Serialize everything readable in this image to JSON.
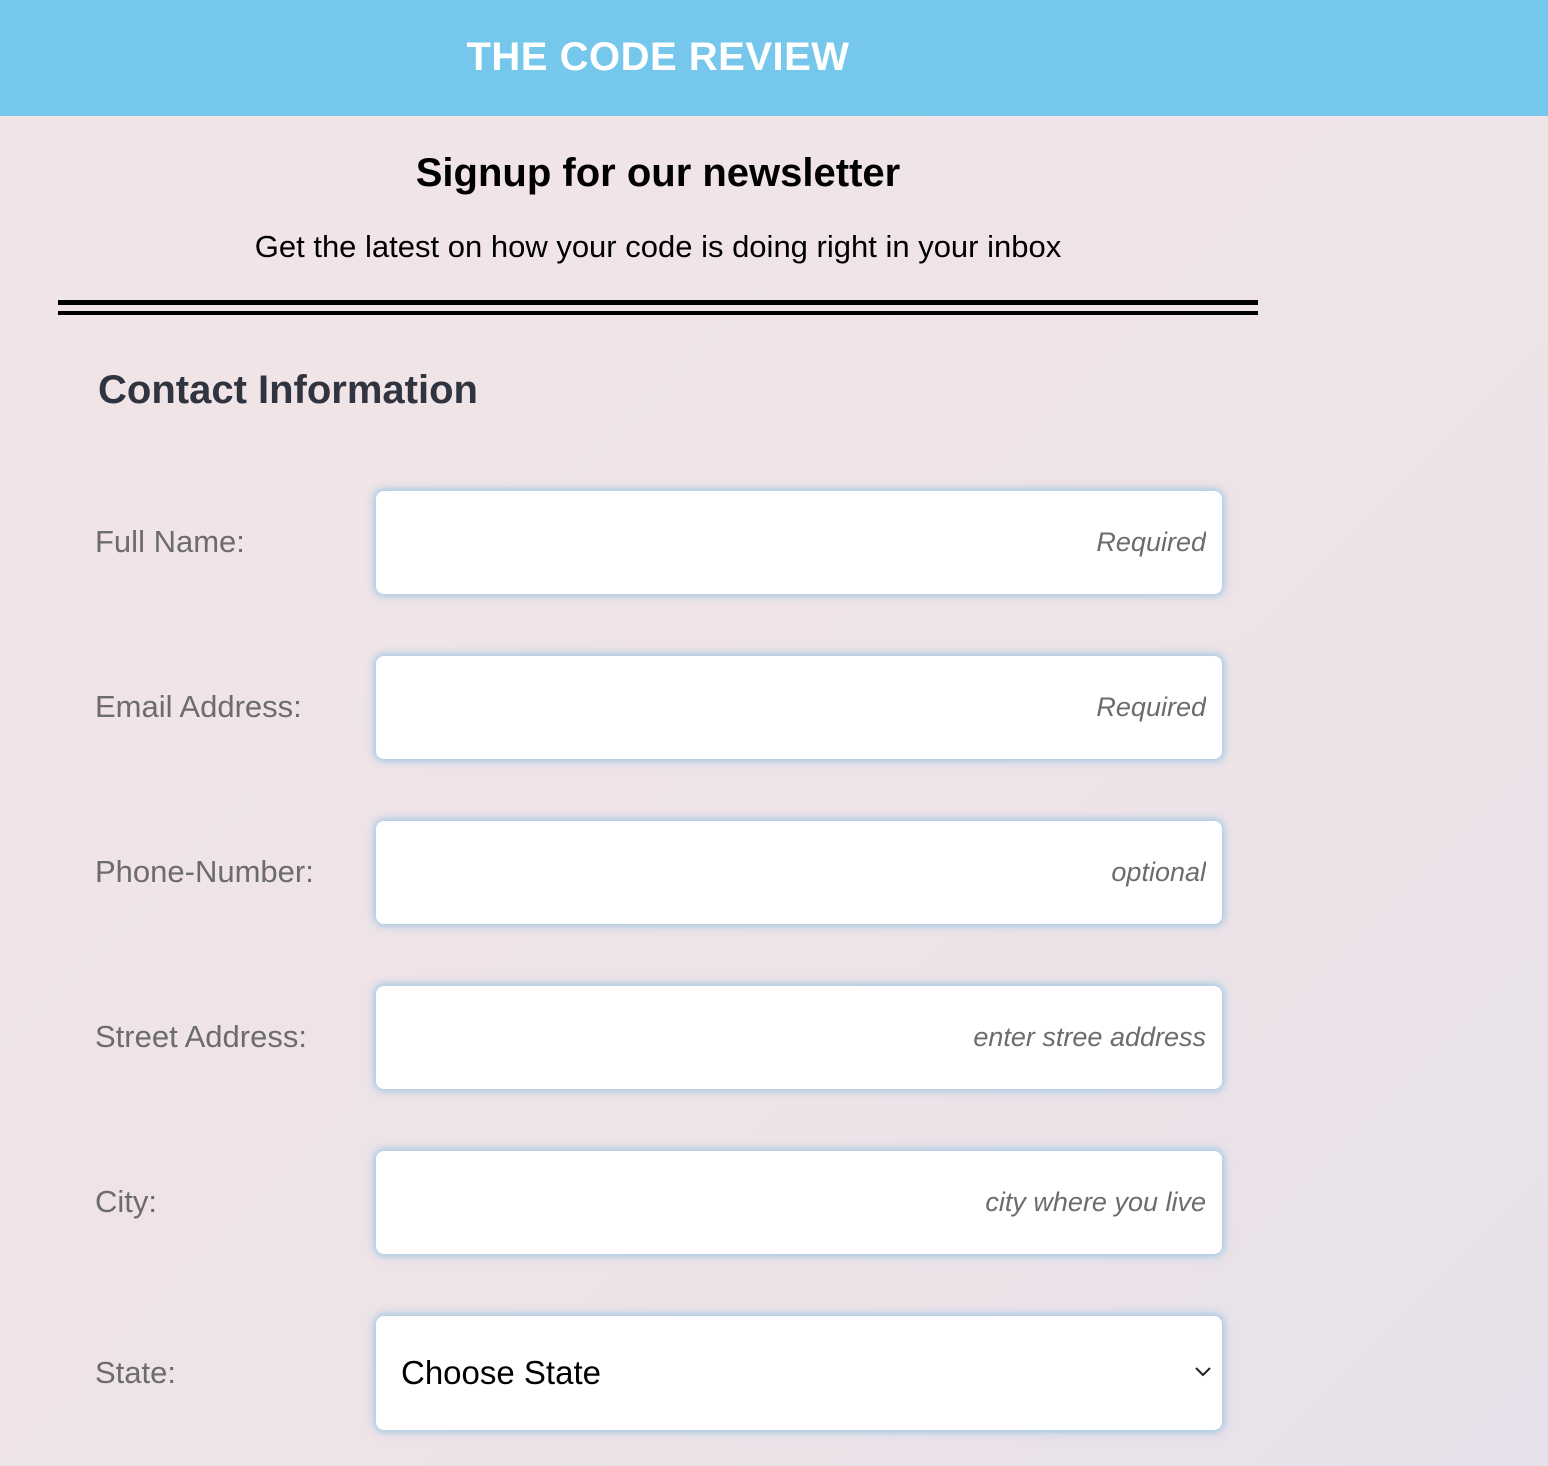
{
  "header": {
    "title": "THE CODE REVIEW"
  },
  "intro": {
    "title": "Signup for our newsletter",
    "subtitle": "Get the latest on how your code is doing right in your inbox"
  },
  "contact": {
    "section_title": "Contact Information",
    "fields": [
      {
        "label": "Full Name:",
        "value": "",
        "placeholder": "Required"
      },
      {
        "label": "Email Address:",
        "value": "",
        "placeholder": "Required"
      },
      {
        "label": "Phone-Number:",
        "value": "",
        "placeholder": "optional"
      },
      {
        "label": "Street Address:",
        "value": "",
        "placeholder": "enter stree address"
      },
      {
        "label": "City:",
        "value": "",
        "placeholder": "city where you live"
      }
    ],
    "state": {
      "label": "State:",
      "selected": "Choose State",
      "icon": "chevron-down-icon"
    }
  },
  "colors": {
    "header_bg": "#75c7eb",
    "field_glow": "#82bee1",
    "label_text": "#6c6c70",
    "section_title": "#2f3440"
  }
}
